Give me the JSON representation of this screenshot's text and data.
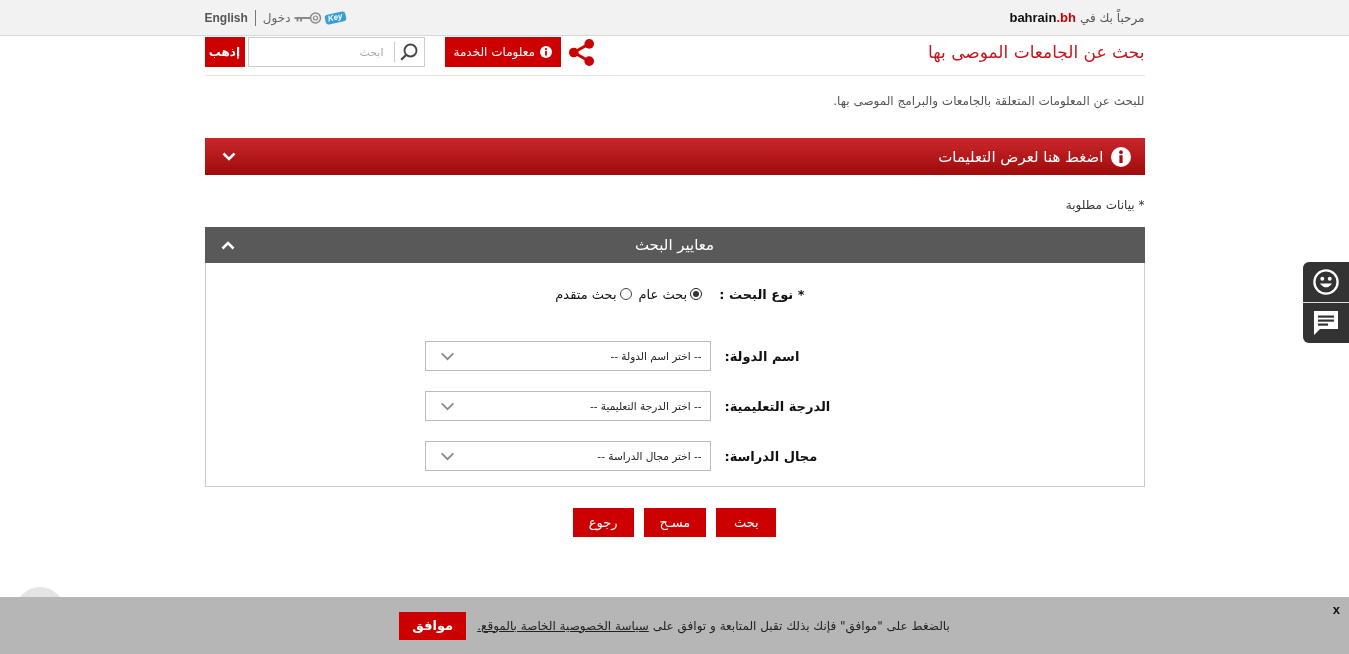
{
  "top_bar": {
    "welcome": "مرحباً بك في",
    "brand": {
      "name": "bahrain",
      "suffix": ".bh"
    },
    "key_badge": "Key",
    "login_link": "دخول",
    "language_link": "English"
  },
  "header": {
    "title": "بحث عن الجامعات الموصى بها",
    "service_info_button": "معلومات الخدمة",
    "search": {
      "placeholder": "ابحث"
    },
    "go_button": "إذهب"
  },
  "description": "للبحث عن المعلومات المتعلقة بالجامعات والبرامج الموصى بها.",
  "instructions_bar": {
    "label": "اضغط هنا لعرض التعليمات",
    "expanded": false
  },
  "required_note": "* بيانات مطلوبة",
  "criteria_panel": {
    "title": "معايير البحث",
    "expanded": true,
    "search_type": {
      "label": "* نوع البحث :",
      "options": [
        {
          "label": "بحث عام",
          "selected": true
        },
        {
          "label": "بحث متقدم",
          "selected": false
        }
      ]
    },
    "fields": [
      {
        "label": "اسم الدولة:",
        "placeholder": "-- اختر اسم الدولة --"
      },
      {
        "label": "الدرجة التعليمية:",
        "placeholder": "-- اختر الدرجة التعليمية --"
      },
      {
        "label": "مجال الدراسة:",
        "placeholder": "-- اختر مجال الدراسة --"
      }
    ]
  },
  "buttons": [
    "بحث",
    "مسـح",
    "رجوع"
  ],
  "cookie_bar": {
    "text": "بالضغط على \"موافق\" فإنك بذلك تقبل المتابعة و توافق على",
    "link": "سياسة الخصوصية الخاصة بالموقع.",
    "accept_button": "موافق",
    "close_button": "x"
  }
}
